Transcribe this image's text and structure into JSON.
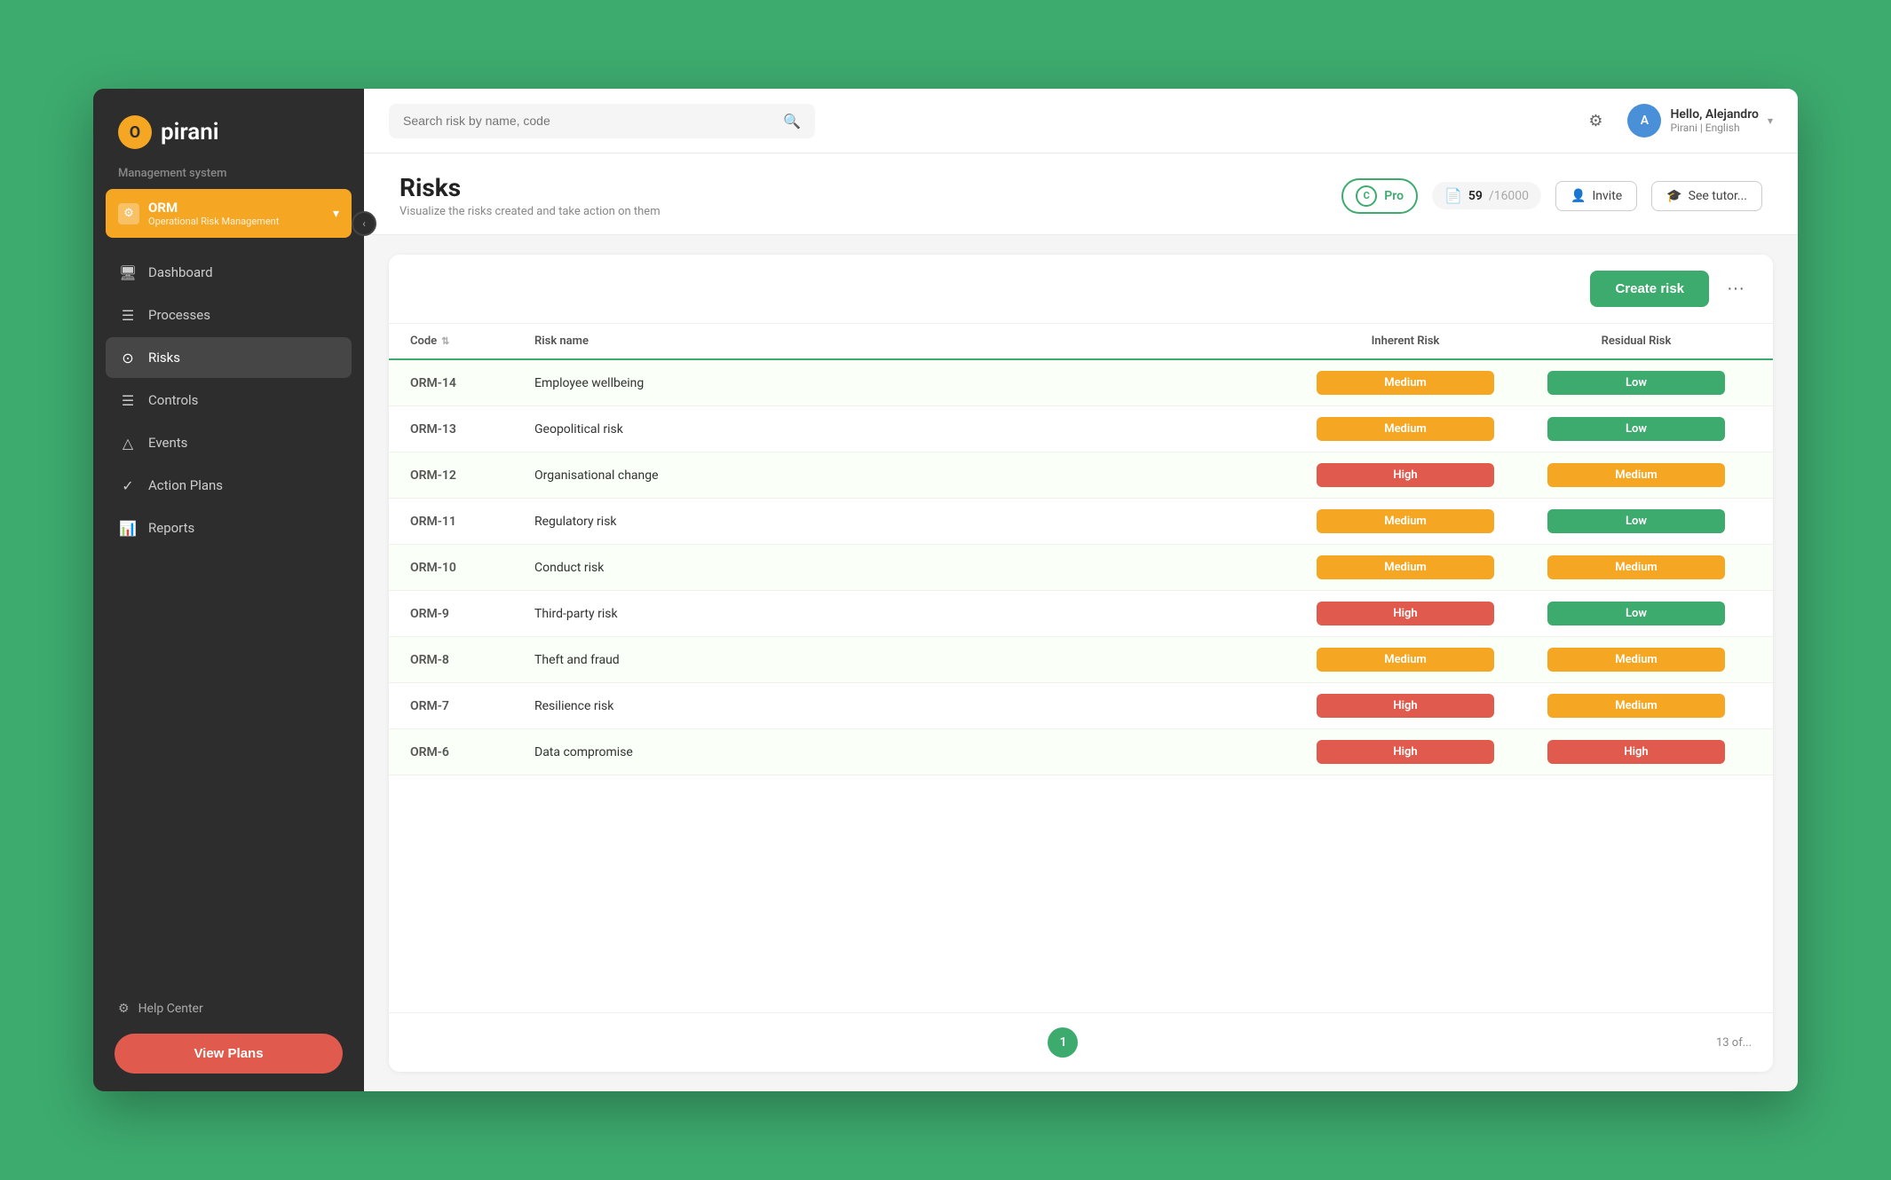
{
  "app": {
    "logo_text": "pirani",
    "logo_letter": "O"
  },
  "sidebar": {
    "management_label": "Management system",
    "orm": {
      "title": "ORM",
      "subtitle": "Operational Risk Management"
    },
    "nav_items": [
      {
        "id": "dashboard",
        "label": "Dashboard",
        "icon": "🖥"
      },
      {
        "id": "processes",
        "label": "Processes",
        "icon": "☰"
      },
      {
        "id": "risks",
        "label": "Risks",
        "icon": "⊙",
        "active": true
      },
      {
        "id": "controls",
        "label": "Controls",
        "icon": "☰"
      },
      {
        "id": "events",
        "label": "Events",
        "icon": "△"
      },
      {
        "id": "action-plans",
        "label": "Action Plans",
        "icon": "✓"
      },
      {
        "id": "reports",
        "label": "Reports",
        "icon": "📊"
      }
    ],
    "help_center_label": "Help Center",
    "view_plans_label": "View Plans"
  },
  "topbar": {
    "search_placeholder": "Search risk by name, code",
    "user_name": "Hello, Alejandro",
    "user_org": "Pirani | English",
    "user_initials": "A"
  },
  "page_header": {
    "title": "Risks",
    "subtitle": "Visualize the risks created and take action on them",
    "pro_label": "Pro",
    "count_current": "59",
    "count_total": "/16000",
    "invite_label": "Invite",
    "tutorial_label": "See tutor..."
  },
  "toolbar": {
    "create_risk_label": "Create risk",
    "more_icon": "···"
  },
  "table": {
    "headers": [
      {
        "id": "code",
        "label": "Code",
        "sortable": true
      },
      {
        "id": "risk_name",
        "label": "Risk name",
        "sortable": false
      },
      {
        "id": "inherent_risk",
        "label": "Inherent Risk",
        "sortable": false
      },
      {
        "id": "residual_risk",
        "label": "Residual Risk",
        "sortable": false
      }
    ],
    "rows": [
      {
        "code": "ORM-14",
        "name": "Employee wellbeing",
        "inherent": "Medium",
        "inherent_class": "badge-medium",
        "residual": "Low",
        "residual_class": "badge-low"
      },
      {
        "code": "ORM-13",
        "name": "Geopolitical risk",
        "inherent": "Medium",
        "inherent_class": "badge-medium",
        "residual": "Low",
        "residual_class": "badge-low"
      },
      {
        "code": "ORM-12",
        "name": "Organisational change",
        "inherent": "High",
        "inherent_class": "badge-high",
        "residual": "Medium",
        "residual_class": "badge-medium"
      },
      {
        "code": "ORM-11",
        "name": "Regulatory risk",
        "inherent": "Medium",
        "inherent_class": "badge-medium",
        "residual": "Low",
        "residual_class": "badge-low"
      },
      {
        "code": "ORM-10",
        "name": "Conduct risk",
        "inherent": "Medium",
        "inherent_class": "badge-medium",
        "residual": "Medium",
        "residual_class": "badge-medium"
      },
      {
        "code": "ORM-9",
        "name": "Third-party risk",
        "inherent": "High",
        "inherent_class": "badge-high",
        "residual": "Low",
        "residual_class": "badge-low"
      },
      {
        "code": "ORM-8",
        "name": "Theft and fraud",
        "inherent": "Medium",
        "inherent_class": "badge-medium",
        "residual": "Medium",
        "residual_class": "badge-medium"
      },
      {
        "code": "ORM-7",
        "name": "Resilience risk",
        "inherent": "High",
        "inherent_class": "badge-high",
        "residual": "Medium",
        "residual_class": "badge-medium"
      },
      {
        "code": "ORM-6",
        "name": "Data compromise",
        "inherent": "High",
        "inherent_class": "badge-high",
        "residual": "High",
        "residual_class": "badge-high"
      }
    ]
  },
  "pagination": {
    "current_page": "1",
    "total_text": "13 of..."
  }
}
